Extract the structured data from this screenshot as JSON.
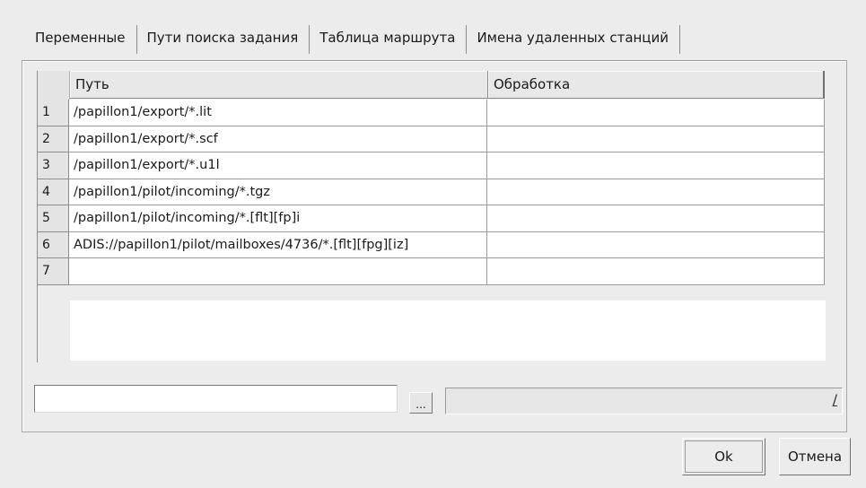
{
  "tabs": [
    {
      "label": "Переменные"
    },
    {
      "label": "Пути поиска задания"
    },
    {
      "label": "Таблица маршрута"
    },
    {
      "label": "Имена удаленных станций"
    }
  ],
  "table": {
    "columns": [
      "Путь",
      "Обработка"
    ],
    "rows": [
      {
        "num": "1",
        "path": "/papillon1/export/*.lit",
        "processing": ""
      },
      {
        "num": "2",
        "path": "/papillon1/export/*.scf",
        "processing": ""
      },
      {
        "num": "3",
        "path": "/papillon1/export/*.u1l",
        "processing": ""
      },
      {
        "num": "4",
        "path": "/papillon1/pilot/incoming/*.tgz",
        "processing": ""
      },
      {
        "num": "5",
        "path": "/papillon1/pilot/incoming/*.[flt][fp]i",
        "processing": ""
      },
      {
        "num": "6",
        "path": "ADIS://papillon1/pilot/mailboxes/4736/*.[flt][fpg][iz]",
        "processing": ""
      },
      {
        "num": "7",
        "path": "",
        "processing": ""
      }
    ]
  },
  "editor": {
    "path_value": "",
    "browse_label": "...",
    "combo_value": "",
    "combo_arrow": "/"
  },
  "buttons": {
    "ok_label": "Ok",
    "cancel_label": "Отмена"
  }
}
